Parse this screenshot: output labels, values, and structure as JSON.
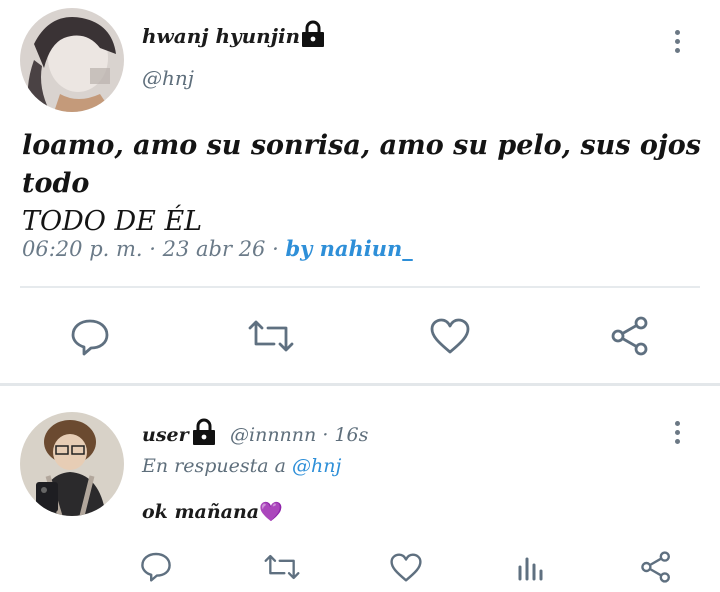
{
  "tweet": {
    "author_name": "hwanj hyunjin",
    "author_handle": "@hnj",
    "text_line1": "loamo, amo su sonrisa, amo su pelo, sus ojos todo",
    "text_line2": "TODO DE ÉL",
    "time": "06:20 p. m.",
    "date": "· 23 abr 26 ·",
    "by": "by nahiun_",
    "avatar_icon": "profile-photo",
    "locked_icon": "lock-icon"
  },
  "reply": {
    "author_name": "user",
    "author_handle": "@innnnn",
    "age": "· 16s",
    "reply_prefix": "En respuesta a",
    "reply_target": "@hnj",
    "text": "ok mañana",
    "emoji": "💜"
  },
  "colors": {
    "accent": "#2e8fd8",
    "icon": "#5f7080",
    "divider": "#e6eaed"
  }
}
